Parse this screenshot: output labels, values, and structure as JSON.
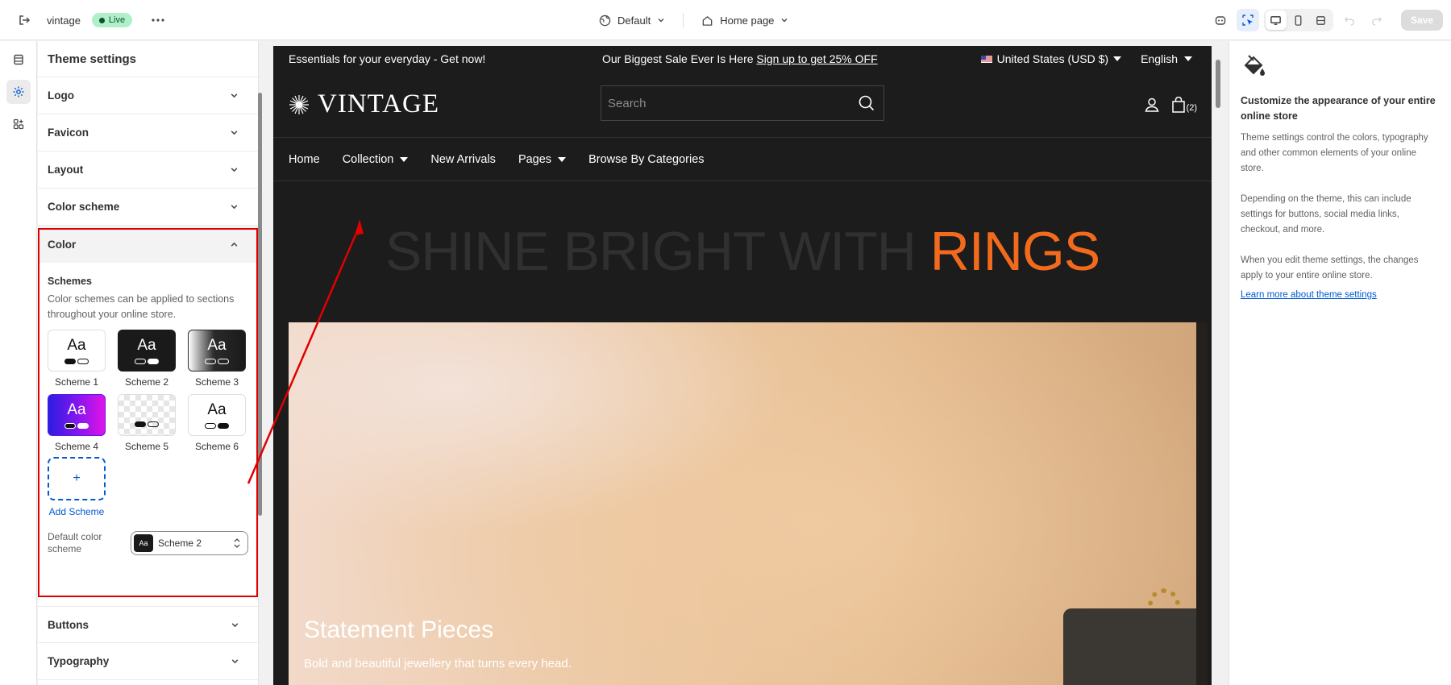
{
  "topbar": {
    "store_name": "vintage",
    "live_label": "Live",
    "theme_select": "Default",
    "page_select": "Home page",
    "save_label": "Save"
  },
  "panel": {
    "title": "Theme settings",
    "sections_top": [
      "Logo",
      "Favicon",
      "Layout",
      "Color scheme"
    ],
    "color_section": "Color",
    "schemes_heading": "Schemes",
    "schemes_desc": "Color schemes can be applied to sections throughout your online store.",
    "schemes": [
      {
        "label": "Scheme 1",
        "sample": "Aa"
      },
      {
        "label": "Scheme 2",
        "sample": "Aa"
      },
      {
        "label": "Scheme 3",
        "sample": "Aa"
      },
      {
        "label": "Scheme 4",
        "sample": "Aa"
      },
      {
        "label": "Scheme 5",
        "sample": ""
      },
      {
        "label": "Scheme 6",
        "sample": "Aa"
      }
    ],
    "add_plus": "+",
    "add_label": "Add Scheme",
    "default_label": "Default color scheme",
    "default_value": "Scheme 2",
    "default_swatch_sample": "Aa",
    "sections_bottom": [
      "Buttons",
      "Typography"
    ]
  },
  "preview": {
    "announce_left": "Essentials for your everyday - Get now!",
    "announce_mid": "Our Biggest Sale Ever Is Here",
    "announce_link": "Sign up to get 25% OFF",
    "currency": "United States (USD $)",
    "language": "English",
    "logo_text": "VINTAGE",
    "search_placeholder": "Search",
    "cart_count": "(2)",
    "nav": [
      "Home",
      "Collection",
      "New Arrivals",
      "Pages",
      "Browse By Categories"
    ],
    "hero_title": "SHINE BRIGHT WITH",
    "hero_accent": "RINGS",
    "hero_heading": "Statement Pieces",
    "hero_sub": "Bold and beautiful jewellery that turns every head."
  },
  "help": {
    "title": "Customize the appearance of your entire online store",
    "p1": "Theme settings control the colors, typography and other common elements of your online store.",
    "p2": "Depending on the theme, this can include settings for buttons, social media links, checkout, and more.",
    "p3": "When you edit theme settings, the changes apply to your entire online store.",
    "link": "Learn more about theme settings"
  },
  "colors": {
    "accent": "#f26b1d",
    "annotation": "#e00000",
    "link": "#005bd3",
    "live_badge": "#aff0c9"
  }
}
